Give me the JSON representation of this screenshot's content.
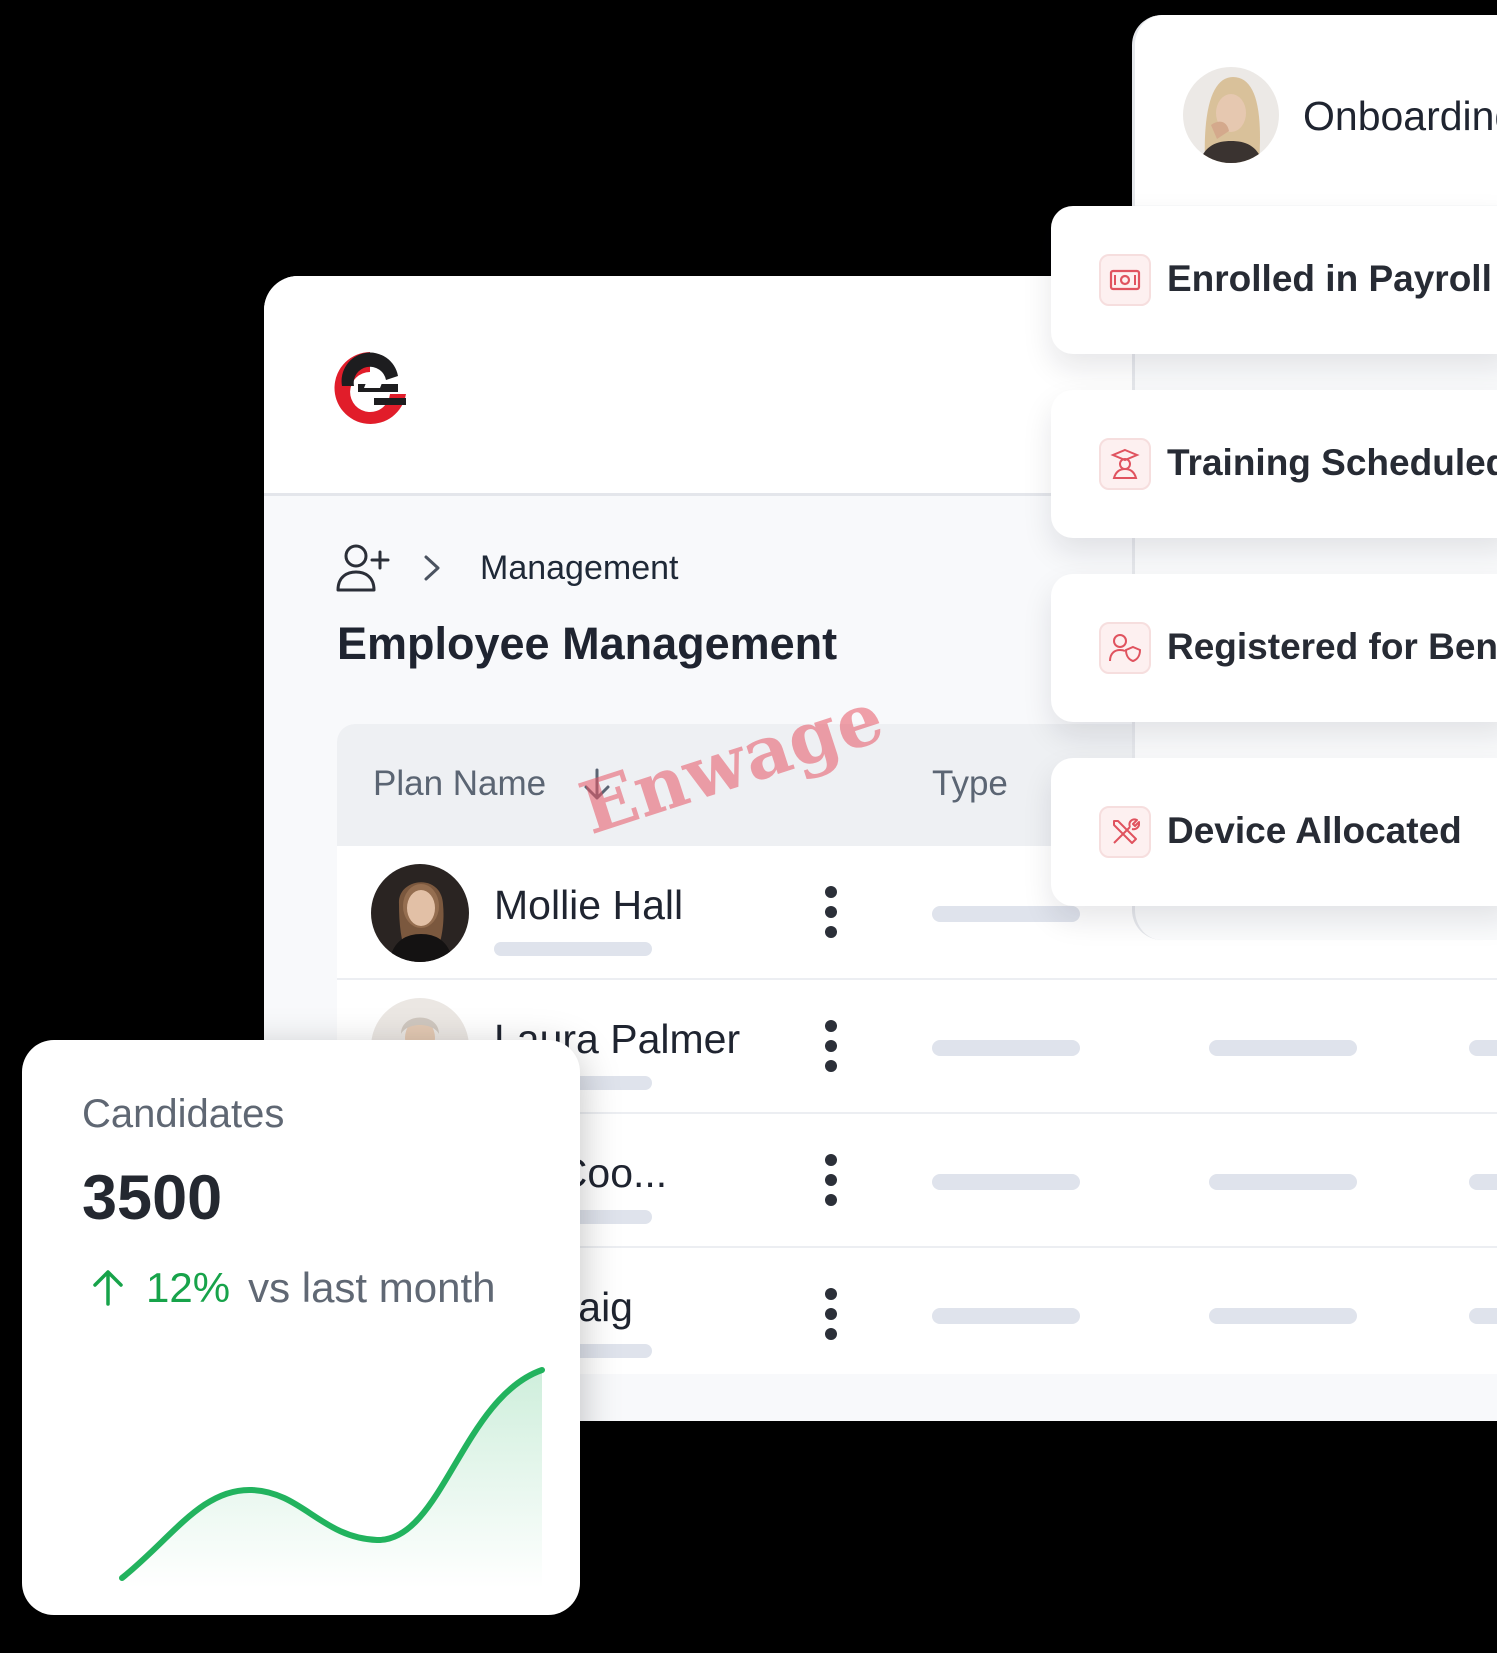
{
  "app": {
    "logo_icon": "brand-logo-icon",
    "brand_colors": {
      "red": "#e11d2a",
      "dark": "#1d1d1f"
    }
  },
  "breadcrumb": {
    "icon": "user-plus-icon",
    "separator_icon": "chevron-right-icon",
    "current": "Management"
  },
  "page": {
    "title": "Employee Management"
  },
  "table": {
    "columns": [
      {
        "label": "Plan Name",
        "sort_icon": "arrow-down-icon"
      },
      {
        "label": "Type"
      }
    ],
    "rows": [
      {
        "name": "Mollie Hall",
        "avatar_icon": "avatar-photo"
      },
      {
        "name": "Laura Palmer",
        "avatar_icon": "avatar-photo"
      },
      {
        "name": "Natalie Coo...",
        "visible_name": "ılie Coo...",
        "avatar_icon": "avatar-photo"
      },
      {
        "name": "Kali Craig",
        "visible_name": "ıli Craig",
        "avatar_icon": "avatar-photo"
      }
    ],
    "row_menu_icon": "more-vertical-icon"
  },
  "onboarding": {
    "title": "Onboarding",
    "avatar_icon": "avatar-photo",
    "steps": [
      {
        "label": "Enrolled in Payroll",
        "icon": "banknote-icon"
      },
      {
        "label": "Training Scheduled",
        "icon": "graduation-user-icon"
      },
      {
        "label": "Registered for Bene",
        "icon": "user-shield-icon"
      },
      {
        "label": "Device Allocated",
        "icon": "tools-icon"
      }
    ]
  },
  "candidates": {
    "label": "Candidates",
    "value": "3500",
    "trend_icon": "arrow-up-icon",
    "change": "12%",
    "comparison": "vs last month",
    "trend_color": "#22b35e"
  },
  "watermark": "Enwage"
}
